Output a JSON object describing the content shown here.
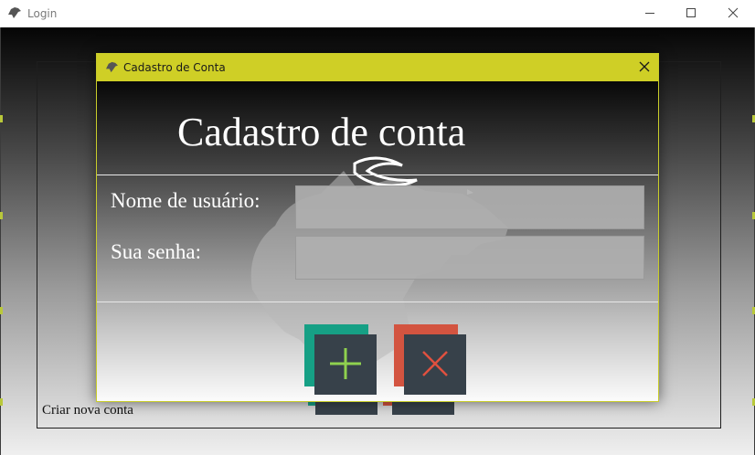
{
  "window": {
    "title": "Login",
    "icon": "wolf-logo-icon",
    "controls": [
      "minimize-icon",
      "maximize-icon",
      "close-icon"
    ]
  },
  "main": {
    "create_account_link": "Criar nova conta"
  },
  "dialog": {
    "title": "Cadastro de Conta",
    "icon": "wolf-logo-icon",
    "heading": "Cadastro de conta",
    "username_label": "Nome de usuário:",
    "username_value": "",
    "password_label": "Sua senha:",
    "password_value": "",
    "buttons": [
      {
        "name": "add-button",
        "icon": "plus-icon",
        "accent": "#16a085",
        "glyph_color": "#8fd14f"
      },
      {
        "name": "cancel-button",
        "icon": "x-icon",
        "accent": "#d35440",
        "glyph_color": "#e0503f"
      }
    ]
  },
  "colors": {
    "dialog_titlebar": "#cfcf26",
    "button_face": "#37414a",
    "add_accent": "#16a085",
    "cancel_accent": "#d35440"
  }
}
